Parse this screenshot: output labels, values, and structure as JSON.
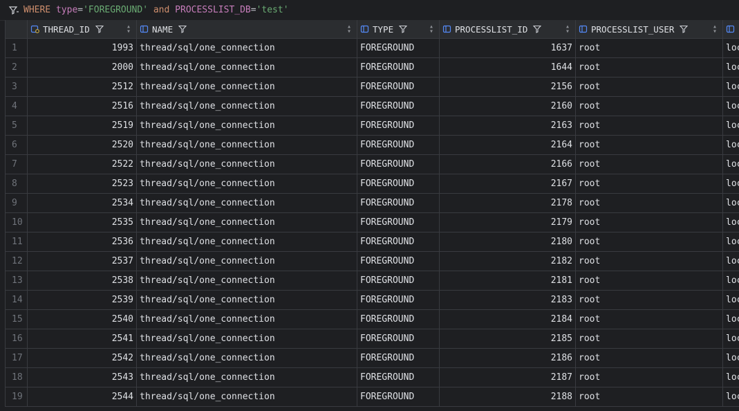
{
  "filter": {
    "kw_where": "WHERE",
    "col1": "type",
    "eq1": "=",
    "val1": "'FOREGROUND'",
    "kw_and": "and",
    "col2": "PROCESSLIST_DB",
    "eq2": "=",
    "val2": "'test'"
  },
  "columns": [
    {
      "label": "THREAD_ID",
      "icon": "key-column-icon"
    },
    {
      "label": "NAME",
      "icon": "column-icon"
    },
    {
      "label": "TYPE",
      "icon": "column-icon"
    },
    {
      "label": "PROCESSLIST_ID",
      "icon": "column-icon"
    },
    {
      "label": "PROCESSLIST_USER",
      "icon": "column-icon"
    },
    {
      "label": "",
      "icon": "column-icon"
    }
  ],
  "rows": [
    {
      "n": "1",
      "thread_id": "1993",
      "name": "thread/sql/one_connection",
      "type": "FOREGROUND",
      "pl_id": "1637",
      "user": "root",
      "next": "loc"
    },
    {
      "n": "2",
      "thread_id": "2000",
      "name": "thread/sql/one_connection",
      "type": "FOREGROUND",
      "pl_id": "1644",
      "user": "root",
      "next": "loc"
    },
    {
      "n": "3",
      "thread_id": "2512",
      "name": "thread/sql/one_connection",
      "type": "FOREGROUND",
      "pl_id": "2156",
      "user": "root",
      "next": "loc"
    },
    {
      "n": "4",
      "thread_id": "2516",
      "name": "thread/sql/one_connection",
      "type": "FOREGROUND",
      "pl_id": "2160",
      "user": "root",
      "next": "loc"
    },
    {
      "n": "5",
      "thread_id": "2519",
      "name": "thread/sql/one_connection",
      "type": "FOREGROUND",
      "pl_id": "2163",
      "user": "root",
      "next": "loc"
    },
    {
      "n": "6",
      "thread_id": "2520",
      "name": "thread/sql/one_connection",
      "type": "FOREGROUND",
      "pl_id": "2164",
      "user": "root",
      "next": "loc"
    },
    {
      "n": "7",
      "thread_id": "2522",
      "name": "thread/sql/one_connection",
      "type": "FOREGROUND",
      "pl_id": "2166",
      "user": "root",
      "next": "loc"
    },
    {
      "n": "8",
      "thread_id": "2523",
      "name": "thread/sql/one_connection",
      "type": "FOREGROUND",
      "pl_id": "2167",
      "user": "root",
      "next": "loc"
    },
    {
      "n": "9",
      "thread_id": "2534",
      "name": "thread/sql/one_connection",
      "type": "FOREGROUND",
      "pl_id": "2178",
      "user": "root",
      "next": "loc"
    },
    {
      "n": "10",
      "thread_id": "2535",
      "name": "thread/sql/one_connection",
      "type": "FOREGROUND",
      "pl_id": "2179",
      "user": "root",
      "next": "loc"
    },
    {
      "n": "11",
      "thread_id": "2536",
      "name": "thread/sql/one_connection",
      "type": "FOREGROUND",
      "pl_id": "2180",
      "user": "root",
      "next": "loc"
    },
    {
      "n": "12",
      "thread_id": "2537",
      "name": "thread/sql/one_connection",
      "type": "FOREGROUND",
      "pl_id": "2182",
      "user": "root",
      "next": "loc"
    },
    {
      "n": "13",
      "thread_id": "2538",
      "name": "thread/sql/one_connection",
      "type": "FOREGROUND",
      "pl_id": "2181",
      "user": "root",
      "next": "loc"
    },
    {
      "n": "14",
      "thread_id": "2539",
      "name": "thread/sql/one_connection",
      "type": "FOREGROUND",
      "pl_id": "2183",
      "user": "root",
      "next": "loc"
    },
    {
      "n": "15",
      "thread_id": "2540",
      "name": "thread/sql/one_connection",
      "type": "FOREGROUND",
      "pl_id": "2184",
      "user": "root",
      "next": "loc"
    },
    {
      "n": "16",
      "thread_id": "2541",
      "name": "thread/sql/one_connection",
      "type": "FOREGROUND",
      "pl_id": "2185",
      "user": "root",
      "next": "loc"
    },
    {
      "n": "17",
      "thread_id": "2542",
      "name": "thread/sql/one_connection",
      "type": "FOREGROUND",
      "pl_id": "2186",
      "user": "root",
      "next": "loc"
    },
    {
      "n": "18",
      "thread_id": "2543",
      "name": "thread/sql/one_connection",
      "type": "FOREGROUND",
      "pl_id": "2187",
      "user": "root",
      "next": "loc"
    },
    {
      "n": "19",
      "thread_id": "2544",
      "name": "thread/sql/one_connection",
      "type": "FOREGROUND",
      "pl_id": "2188",
      "user": "root",
      "next": "loc"
    }
  ],
  "colors": {
    "background": "#1e1f22",
    "header": "#2b2d30",
    "keyword": "#cf8e6d",
    "string": "#6aab73",
    "identifier": "#c77dbb",
    "column_icon": "#548af7"
  }
}
